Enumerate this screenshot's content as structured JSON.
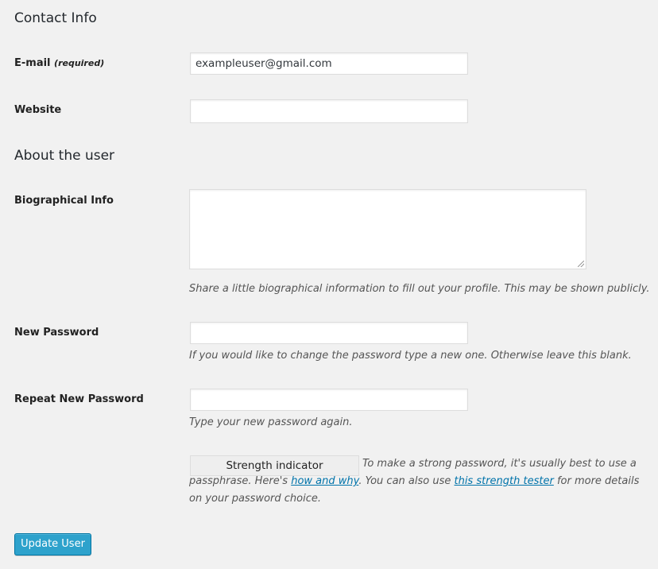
{
  "contact": {
    "heading": "Contact Info",
    "email_label": "E-mail",
    "email_required": "(required)",
    "email_value": "exampleuser@gmail.com",
    "website_label": "Website",
    "website_value": ""
  },
  "about": {
    "heading": "About the user",
    "bio_label": "Biographical Info",
    "bio_value": "",
    "bio_description": "Share a little biographical information to fill out your profile. This may be shown publicly."
  },
  "password": {
    "new_label": "New Password",
    "new_description": "If you would like to change the password type a new one. Otherwise leave this blank.",
    "repeat_label": "Repeat New Password",
    "repeat_description": "Type your new password again.",
    "strength_indicator": "Strength indicator",
    "hint_part1": "To make a strong password, it's usually best to use a passphrase. Here's ",
    "hint_link1": "how and why",
    "hint_part2": ". You can also use ",
    "hint_link2": "this strength tester",
    "hint_part3": " for more details on your password choice."
  },
  "actions": {
    "update_label": "Update User"
  },
  "colors": {
    "background": "#f1f1f1",
    "primary_button": "#2ea2cc",
    "link": "#0073aa"
  }
}
